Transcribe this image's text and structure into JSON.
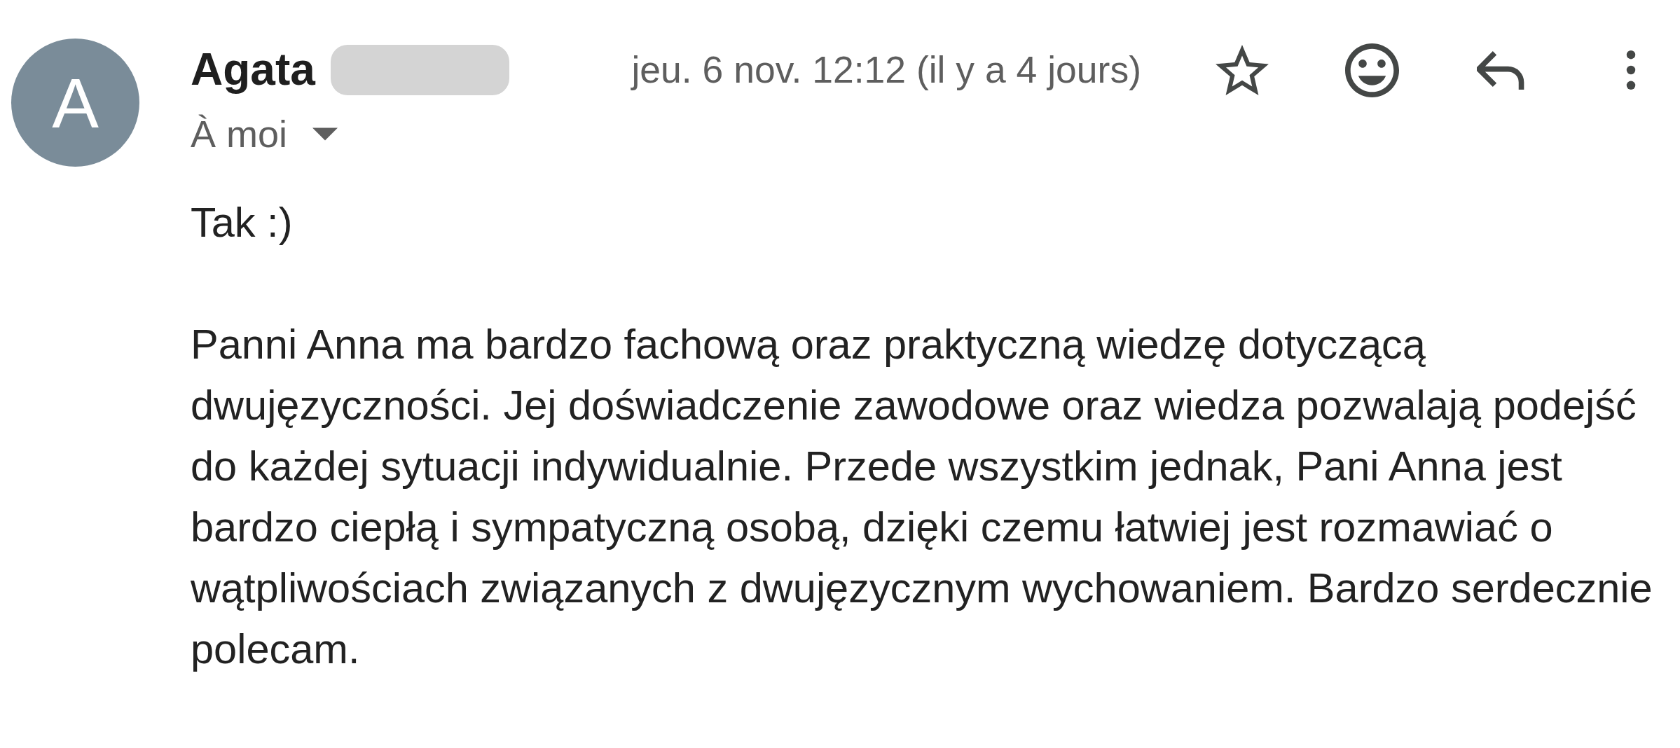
{
  "sender": {
    "avatar_letter": "A",
    "name": "Agata",
    "redacted": true
  },
  "date": "jeu. 6 nov. 12:12 (il y a 4 jours)",
  "actions": [
    {
      "kind": "star",
      "starred": false
    },
    {
      "kind": "emoji"
    },
    {
      "kind": "reply"
    },
    {
      "kind": "more"
    }
  ],
  "recipient": {
    "label": "À moi"
  },
  "body": [
    "Tak :)",
    "Panni Anna ma bardzo fachową oraz praktyczną wiedzę dotyczącą dwujęzyczności. Jej doświadczenie zawodowe oraz wiedza pozwalają podejść do każdej sytuacji indywidualnie. Przede wszystkim jednak, Pani Anna jest bardzo ciepłą i sympatyczną osobą, dzięki czemu łatwiej jest rozmawiać o wątpliwościach związanych z dwujęzycznym wychowaniem. Bardzo serdecznie polecam."
  ]
}
